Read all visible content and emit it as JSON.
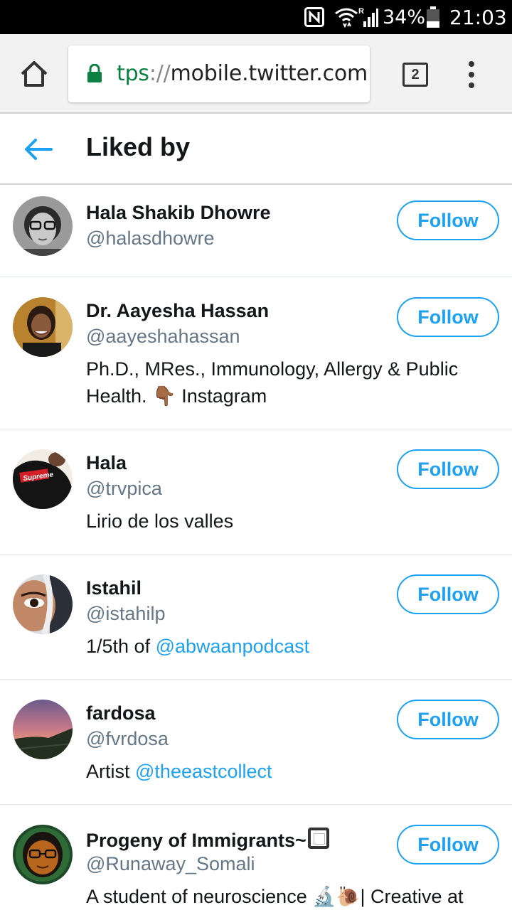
{
  "status_bar": {
    "battery": "34%",
    "time": "21:03",
    "network_label": "R"
  },
  "browser": {
    "url_scheme": "tps",
    "url_sep": "://",
    "url_host": "mobile.twitter.com",
    "tab_count": "2"
  },
  "header": {
    "title": "Liked by"
  },
  "users": [
    {
      "name": "Hala Shakib Dhowre",
      "handle": "@halasdhowre",
      "follow": "Follow"
    },
    {
      "name": "Dr. Aayesha Hassan",
      "handle": "@aayeshahassan",
      "bio_line1": "Ph.D., MRes., Immunology, Allergy & Public",
      "bio_line2_text": "Health. ",
      "bio_emoji": "👇🏾",
      "bio_line2_rest": " Instagram",
      "follow": "Follow"
    },
    {
      "name": "Hala",
      "handle": "@trvpica",
      "bio": "Lirio de los valles",
      "avatar_text": "Supreme",
      "follow": "Follow"
    },
    {
      "name": "Istahil",
      "handle": "@istahilp",
      "bio_prefix": "1/5th of ",
      "bio_link": "@abwaanpodcast",
      "follow": "Follow"
    },
    {
      "name": "fardosa",
      "handle": "@fvrdosa",
      "bio_prefix": "Artist ",
      "bio_link": "@theeastcollect",
      "follow": "Follow"
    },
    {
      "name": "Progeny of Immigrants~",
      "handle": "@Runaway_Somali",
      "bio_prefix": "A student of neuroscience ",
      "bio_emoji": "🔬🐌",
      "bio_suffix": "| Creative at",
      "follow": "Follow"
    }
  ],
  "colors": {
    "accent": "#1da1f2",
    "secure_green": "#0b8043",
    "handle_gray": "#657786",
    "text": "#14171a"
  },
  "icons": {
    "status": [
      "nfc-icon",
      "wifi-icon",
      "signal-icon",
      "battery-icon"
    ],
    "toolbar": [
      "home-icon",
      "lock-icon",
      "tabs-icon",
      "overflow-menu-icon"
    ],
    "header": [
      "back-arrow-icon"
    ]
  }
}
